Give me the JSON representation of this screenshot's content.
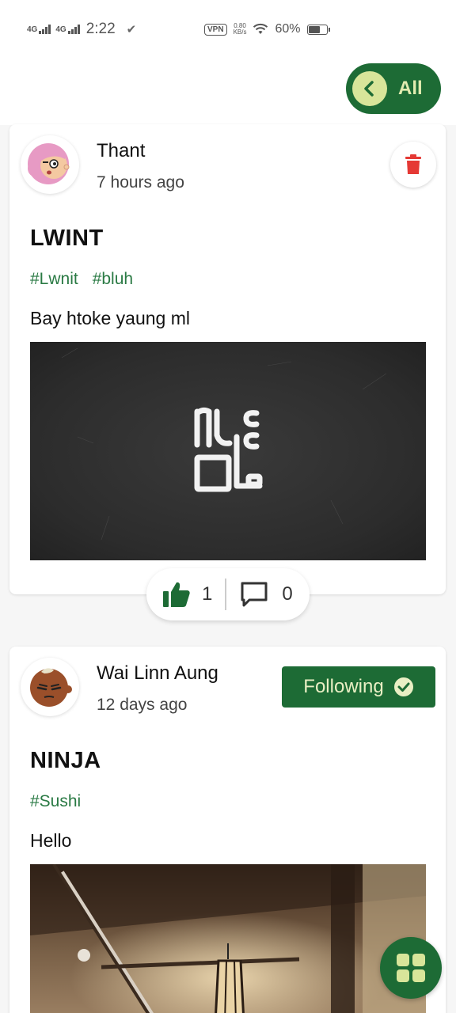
{
  "status_bar": {
    "network_1": "4G",
    "network_2": "4G",
    "time": "2:22",
    "vpn": "VPN",
    "speed_value": "0.80",
    "speed_unit": "KB/s",
    "battery_percent": "60%"
  },
  "filter": {
    "label": "All"
  },
  "posts": [
    {
      "author": "Thant",
      "time_ago": "7 hours ago",
      "title": "LWINT",
      "tags": [
        "#Lwnit",
        "#bluh"
      ],
      "body": "Bay htoke yaung ml",
      "likes": "1",
      "comments": "0"
    },
    {
      "author": "Wai Linn Aung",
      "time_ago": "12 days ago",
      "title": "NINJA",
      "tags": [
        "#Sushi"
      ],
      "body": "Hello",
      "follow_label": "Following"
    }
  ],
  "colors": {
    "brand_green": "#1d6b35",
    "tag_green": "#2a7a44",
    "accent_lime": "#d8e59a",
    "delete_red": "#e53935"
  },
  "icons": [
    "chevron-left-icon",
    "trash-icon",
    "thumbs-up-icon",
    "comment-icon",
    "check-circle-icon",
    "grid-icon"
  ]
}
